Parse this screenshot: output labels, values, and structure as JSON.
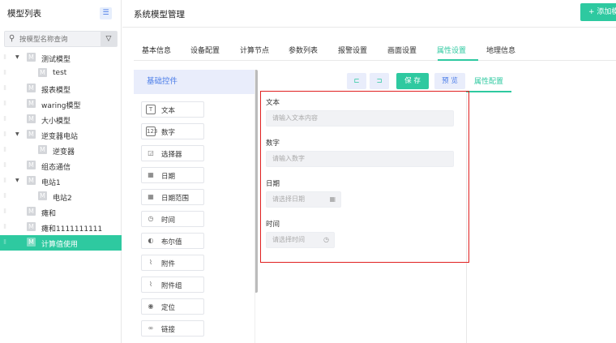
{
  "left": {
    "title": "模型列表",
    "search_placeholder": "按模型名称查询",
    "tree": [
      {
        "label": "测试模型",
        "level": 0,
        "expandable": true,
        "selected": false
      },
      {
        "label": "test",
        "level": 1,
        "expandable": false,
        "selected": false
      },
      {
        "label": "报表模型",
        "level": 0,
        "expandable": false,
        "selected": false
      },
      {
        "label": "waring模型",
        "level": 0,
        "expandable": false,
        "selected": false
      },
      {
        "label": "大小模型",
        "level": 0,
        "expandable": false,
        "selected": false
      },
      {
        "label": "逆变器电站",
        "level": 0,
        "expandable": true,
        "selected": false
      },
      {
        "label": "逆变器",
        "level": 1,
        "expandable": false,
        "selected": false
      },
      {
        "label": "组态通信",
        "level": 0,
        "expandable": false,
        "selected": false
      },
      {
        "label": "电站1",
        "level": 0,
        "expandable": true,
        "selected": false
      },
      {
        "label": "电站2",
        "level": 1,
        "expandable": false,
        "selected": false
      },
      {
        "label": "瘫和",
        "level": 0,
        "expandable": false,
        "selected": false
      },
      {
        "label": "瘫和1111111111",
        "level": 0,
        "expandable": false,
        "selected": false
      },
      {
        "label": "计算值使用",
        "level": 0,
        "expandable": false,
        "selected": true
      }
    ]
  },
  "header": {
    "title": "系统模型管理",
    "add_label": "+ 添加模"
  },
  "tabs": [
    {
      "label": "基本信息",
      "active": false
    },
    {
      "label": "设备配置",
      "active": false
    },
    {
      "label": "计算节点",
      "active": false
    },
    {
      "label": "参数列表",
      "active": false
    },
    {
      "label": "报警设置",
      "active": false
    },
    {
      "label": "画面设置",
      "active": false
    },
    {
      "label": "属性设置",
      "active": true
    },
    {
      "label": "地理信息",
      "active": false
    }
  ],
  "palette": {
    "title": "基础控件",
    "items": [
      {
        "label": "文本",
        "icon": "text-icon",
        "glyph": "T"
      },
      {
        "label": "数字",
        "icon": "number-icon",
        "glyph": "123"
      },
      {
        "label": "选择器",
        "icon": "select-icon",
        "glyph": "◲"
      },
      {
        "label": "日期",
        "icon": "calendar-icon",
        "glyph": "▦"
      },
      {
        "label": "日期范围",
        "icon": "date-range-icon",
        "glyph": "▦"
      },
      {
        "label": "时间",
        "icon": "clock-icon",
        "glyph": "◷"
      },
      {
        "label": "布尔值",
        "icon": "toggle-icon",
        "glyph": "◐"
      },
      {
        "label": "附件",
        "icon": "paperclip-icon",
        "glyph": "⌇"
      },
      {
        "label": "附件组",
        "icon": "paperclip-group-icon",
        "glyph": "⌇"
      },
      {
        "label": "定位",
        "icon": "location-icon",
        "glyph": "◉"
      },
      {
        "label": "链接",
        "icon": "link-icon",
        "glyph": "∞"
      }
    ]
  },
  "toolbar": {
    "save_label": "保 存",
    "preview_label": "预 览",
    "property_tab": "属性配置"
  },
  "form": {
    "fields": [
      {
        "label": "文本",
        "placeholder": "请输入文本内容",
        "icon": ""
      },
      {
        "label": "数字",
        "placeholder": "请输入数字",
        "icon": ""
      },
      {
        "label": "日期",
        "placeholder": "请选择日期",
        "icon": "calendar-icon"
      },
      {
        "label": "时间",
        "placeholder": "请选择时间",
        "icon": "clock-icon"
      }
    ]
  },
  "colors": {
    "accent": "#2ec9a0",
    "blue": "#4a7ce8",
    "highlight_border": "#e02020"
  }
}
